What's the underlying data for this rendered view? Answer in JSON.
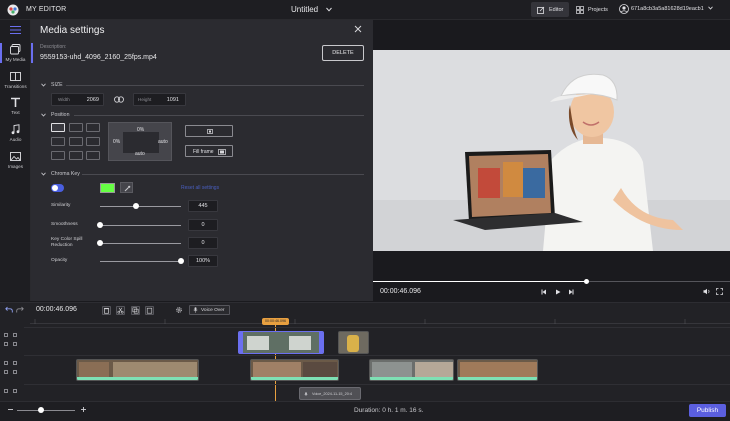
{
  "topbar": {
    "app_title": "MY EDITOR",
    "doc_title": "Untitled",
    "tab_editor": "Editor",
    "tab_projects": "Projects",
    "user_name": "671a8cb3a5a81628d19eacb1"
  },
  "sidebar": {
    "items": [
      {
        "label": "My Media",
        "icon": "media-icon"
      },
      {
        "label": "Transitions",
        "icon": "transitions-icon"
      },
      {
        "label": "Text",
        "icon": "text-icon"
      },
      {
        "label": "Audio",
        "icon": "audio-icon"
      },
      {
        "label": "Images",
        "icon": "images-icon"
      }
    ]
  },
  "panel": {
    "title": "Media settings",
    "description_label": "Description:",
    "description_value": "9559153-uhd_4096_2160_25fps.mp4",
    "delete_label": "DELETE",
    "size": {
      "heading": "SIZE",
      "width_label": "Width",
      "width_value": "2069",
      "height_label": "Height",
      "height_value": "1091"
    },
    "position": {
      "heading": "Position",
      "top_value": "0%",
      "left_value": "0%",
      "right_value": "auto",
      "bottom_value": "auto",
      "fill_frame_label": "Fill frame"
    },
    "chroma": {
      "heading": "Chroma Key",
      "enabled": true,
      "key_color": "#66ff44",
      "reset_label": "Reset all settings",
      "similarity_label": "Similarity",
      "similarity_value": "445",
      "smoothness_label": "Smoothness",
      "smoothness_value": "0",
      "spill_label_1": "Key Color Spill",
      "spill_label_2": "Reduction",
      "spill_value": "0",
      "opacity_label": "Opacity",
      "opacity_value": "100%"
    }
  },
  "preview": {
    "timecode": "00:00:46.096"
  },
  "timeline": {
    "timecode": "00:00:46.096",
    "voice_over_label": "Voice Over",
    "playhead_label": "00:00:46.096",
    "audio_clip_label": "Voice_2024-11-15_20:4"
  },
  "bottombar": {
    "duration_label": "Duration:",
    "duration_value": "0 h. 1 m. 16 s.",
    "publish_label": "Publish"
  },
  "colors": {
    "accent": "#6b6ff0",
    "clip_strip": "#7ee0b4",
    "playhead": "#e8a040",
    "selected_clip_border": "#6b6ff0"
  }
}
